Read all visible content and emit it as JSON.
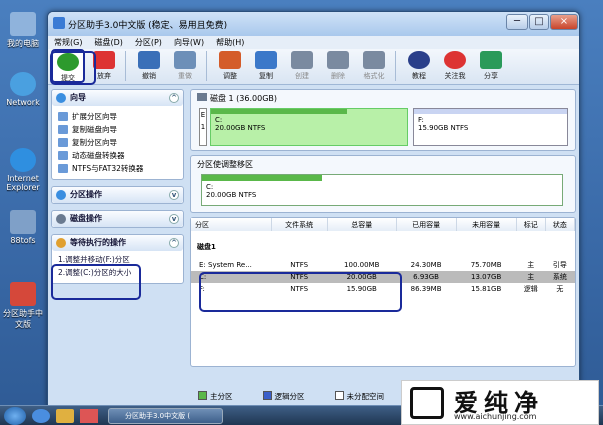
{
  "desktop": {
    "icons": [
      "我的电脑",
      "Network",
      "Internet Explorer",
      "88tofs",
      "分区助手中文版"
    ]
  },
  "window": {
    "title": "分区助手3.0中文版 (稳定、易用且免费)",
    "min": "─",
    "max": "□",
    "close": "×"
  },
  "menu": [
    "常规(G)",
    "磁盘(D)",
    "分区(P)",
    "向导(W)",
    "帮助(H)"
  ],
  "toolbar": {
    "items": [
      {
        "label": "提交",
        "color": "#2d9a2d"
      },
      {
        "label": "放弃",
        "color": "#d33"
      },
      {
        "label": "撤销",
        "color": "#3a6fb8"
      },
      {
        "label": "重做",
        "color": "#6d8fb8"
      },
      {
        "label": "调整",
        "color": "#d45c2a"
      },
      {
        "label": "复制",
        "color": "#3b78c9"
      },
      {
        "label": "创建",
        "color": "#7a8aa0"
      },
      {
        "label": "删除",
        "color": "#7a8aa0"
      },
      {
        "label": "格式化",
        "color": "#7a8aa0"
      },
      {
        "label": "教程",
        "color": "#2a3f8a"
      },
      {
        "label": "关注我",
        "color": "#d33"
      },
      {
        "label": "分享",
        "color": "#2a9a5a"
      }
    ]
  },
  "left": {
    "wizard": {
      "title": "向导",
      "items": [
        "扩展分区向导",
        "复制磁盘向导",
        "复制分区向导",
        "动态磁盘转换器",
        "NTFS与FAT32转换器"
      ]
    },
    "partops": {
      "title": "分区操作"
    },
    "diskops": {
      "title": "磁盘操作"
    },
    "pending": {
      "title": "等待执行的操作",
      "items": [
        "1.调整并移动(F:)分区",
        "2.调整(C:)分区的大小"
      ]
    }
  },
  "disk": {
    "label": "磁盘 1 (36.00GB)",
    "c_name": "C:",
    "c_size": "20.00GB NTFS",
    "f_name": "F:",
    "f_size": "15.90GB NTFS",
    "e_name": "E",
    "e_num": "1"
  },
  "adjust": {
    "title": "分区使调整移区",
    "name": "C:",
    "size": "20.00GB NTFS"
  },
  "table": {
    "headers": [
      "分区",
      "文件系统",
      "总容量",
      "已用容量",
      "未用容量",
      "标记",
      "状态"
    ],
    "group": "磁盘1",
    "rows": [
      [
        "E: System Re...",
        "NTFS",
        "100.00MB",
        "24.30MB",
        "75.70MB",
        "主",
        "引导"
      ],
      [
        "C:",
        "NTFS",
        "20.00GB",
        "6.93GB",
        "13.07GB",
        "主",
        "系统"
      ],
      [
        "F:",
        "NTFS",
        "15.90GB",
        "86.39MB",
        "15.81GB",
        "逻辑",
        "无"
      ]
    ]
  },
  "legend": [
    "主分区",
    "逻辑分区",
    "未分配空间"
  ],
  "taskbar": {
    "item": "分区助手3.0中文版 ("
  },
  "watermark": {
    "text": "爱纯净",
    "url": "www.aichunjing.com"
  }
}
